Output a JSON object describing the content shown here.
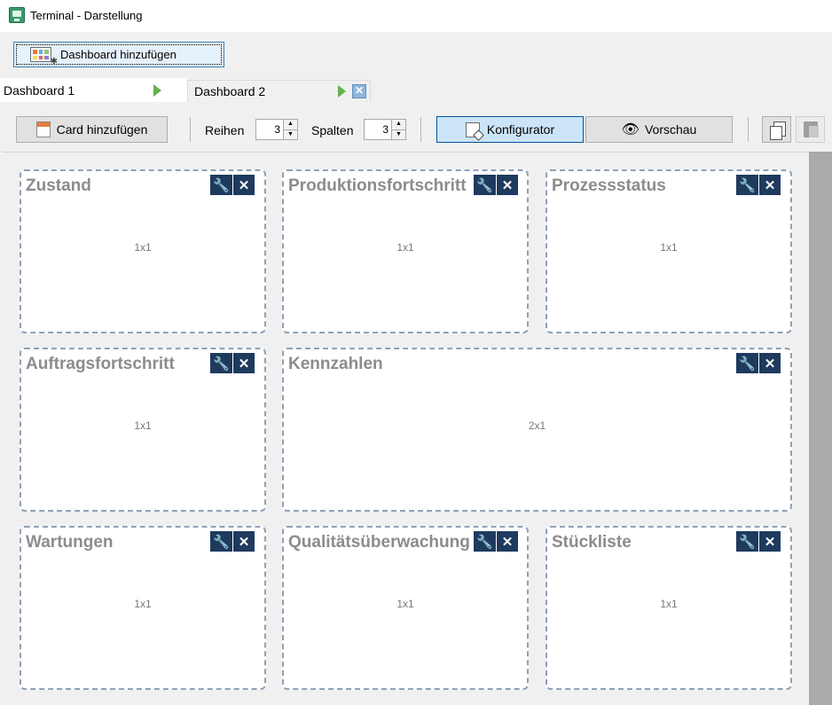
{
  "window": {
    "title": "Terminal - Darstellung"
  },
  "top_button": {
    "label": "Dashboard hinzufügen",
    "icon": "dashboard-grid-icon"
  },
  "tabs": [
    {
      "label": "Dashboard 1",
      "active": true
    },
    {
      "label": "Dashboard 2",
      "active": false
    }
  ],
  "toolbar": {
    "add_card_label": "Card hinzufügen",
    "rows_label": "Reihen",
    "rows_value": "3",
    "cols_label": "Spalten",
    "cols_value": "3",
    "configurator_label": "Konfigurator",
    "preview_label": "Vorschau"
  },
  "cards": [
    {
      "title": "Zustand",
      "size": "1x1"
    },
    {
      "title": "Produktionsfortschritt",
      "size": "1x1"
    },
    {
      "title": "Prozessstatus",
      "size": "1x1"
    },
    {
      "title": "Auftragsfortschritt",
      "size": "1x1"
    },
    {
      "title": "Kennzahlen",
      "size": "2x1"
    },
    {
      "title": "Wartungen",
      "size": "1x1"
    },
    {
      "title": "Qualitätsüberwachung",
      "size": "1x1"
    },
    {
      "title": "Stückliste",
      "size": "1x1"
    }
  ],
  "card_actions": {
    "edit_icon": "wrench-icon",
    "close_icon": "close-icon"
  },
  "colors": {
    "action_bg": "#1f3a5f",
    "card_border": "#8ea1b7",
    "tab_arrow": "#62b34d"
  }
}
